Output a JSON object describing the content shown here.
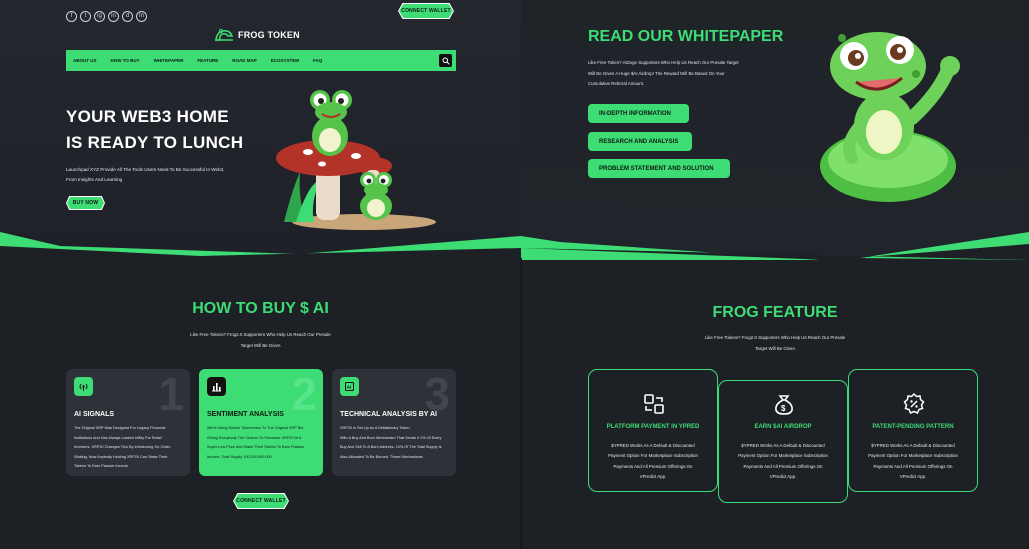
{
  "brand": {
    "name": "FROG TOKEN"
  },
  "header": {
    "socials": [
      "f",
      "t",
      "ig",
      "in",
      "d",
      "m"
    ],
    "connect_wallet": "CONNECT WALLET"
  },
  "nav": {
    "items": [
      "ABOUT US",
      "HOW TO BUY",
      "WHITEPAPER",
      "FEATURE",
      "ROAD MAP",
      "ECOSYSTEM",
      "FAQ"
    ]
  },
  "hero": {
    "title_line1": "YOUR WEB3 HOME",
    "title_line2": "IS READY TO LUNCH",
    "desc_line1": "Launchpad XYZ Provide All The Tools Users Need To Be Successful In Web3,",
    "desc_line2": "From Insights And Learning",
    "buy_now": "BUY NOW"
  },
  "whitepaper": {
    "title": "READ OUR WHITEPAPER",
    "desc_line1": "Like Free Token? AiDoge Supporters Who Help Us Reach Our Presale Target",
    "desc_line2": "Will Be Given A Huge $AI Airdrop! The Reward Will Be Based On Your",
    "desc_line3": "Cumulative Referral Amount.",
    "pills": [
      "IN-DEPTH INFORMATION",
      "RESEARCH AND ANALYSIS",
      "PROBLEM STATEMENT AND SOLUTION"
    ]
  },
  "how_to_buy": {
    "title": "HOW TO BUY $ AI",
    "sub_line1": "Like Free Tokens? Frog2.0 Supporters Who Help Us Reach Our Presale",
    "sub_line2": "Target Will Be Given",
    "cards": [
      {
        "num": "1",
        "title": "AI SIGNALS",
        "lines": [
          "The Original XRP Was Designed For Legacy Financial",
          "Institutions And Has Always Lacked Utility For Retail",
          "Investors. XRP20 Changes This By Introducing On Chain",
          "Staking, Now Anybody Holding XRP20 Can Stake Their",
          "Tokens To Earn Passive Income."
        ]
      },
      {
        "num": "2",
        "title": "SENTIMENT ANALYSIS",
        "lines": [
          "We're Using Similar Tokenomics To The Original XRP But",
          "Giving Everybody The Chance To Purchase XRP20 At A",
          "Super Low Price And Stake Their Tokens To Earn Passive",
          "Income. Total Supply 100,000,000,000"
        ]
      },
      {
        "num": "3",
        "title": "TECHNICAL ANALYSIS BY AI",
        "lines": [
          "XRP20 Is Set Up As A Deflationary Token",
          "With A Buy And Burn Mechanism That Sends 0.1% Of Every",
          "Buy And Sell To A Burn Address. 10% Of The Total Supply Is",
          "Also Allocated To Be Burned. These Mechanisms"
        ]
      }
    ],
    "connect_wallet": "CONNECT WALLET"
  },
  "feature": {
    "title": "FROG FEATURE",
    "sub_line1": "Like Free Tokens? Frog2.0 Supporters Who Help Us Reach Our Presale",
    "sub_line2": "Target Will Be Given",
    "cards": [
      {
        "title": "PLATFORM PAYMENT IN YPRED",
        "lines": [
          "$YPRED Works As A Default & Discounted",
          "Payment Option For Marketplace Subscription",
          "Payments And All Premium Offerings On",
          "VPredict App."
        ]
      },
      {
        "title": "EARN $AI AIRDROP",
        "lines": [
          "$YPRED Works As A Default & Discounted",
          "Payment Option For Marketplace Subscription",
          "Payments And All Premium Offerings On",
          "VPredict App."
        ]
      },
      {
        "title": "PATENT-PENDING PATTERN",
        "lines": [
          "$YPRED Works As A Default & Discounted",
          "Payment Option For Marketplace Subscription",
          "Payments And All Premium Offerings On",
          "VPredict App."
        ]
      }
    ]
  },
  "colors": {
    "accent": "#3ddc74",
    "background": "#1d2126",
    "card": "#2e3238"
  }
}
